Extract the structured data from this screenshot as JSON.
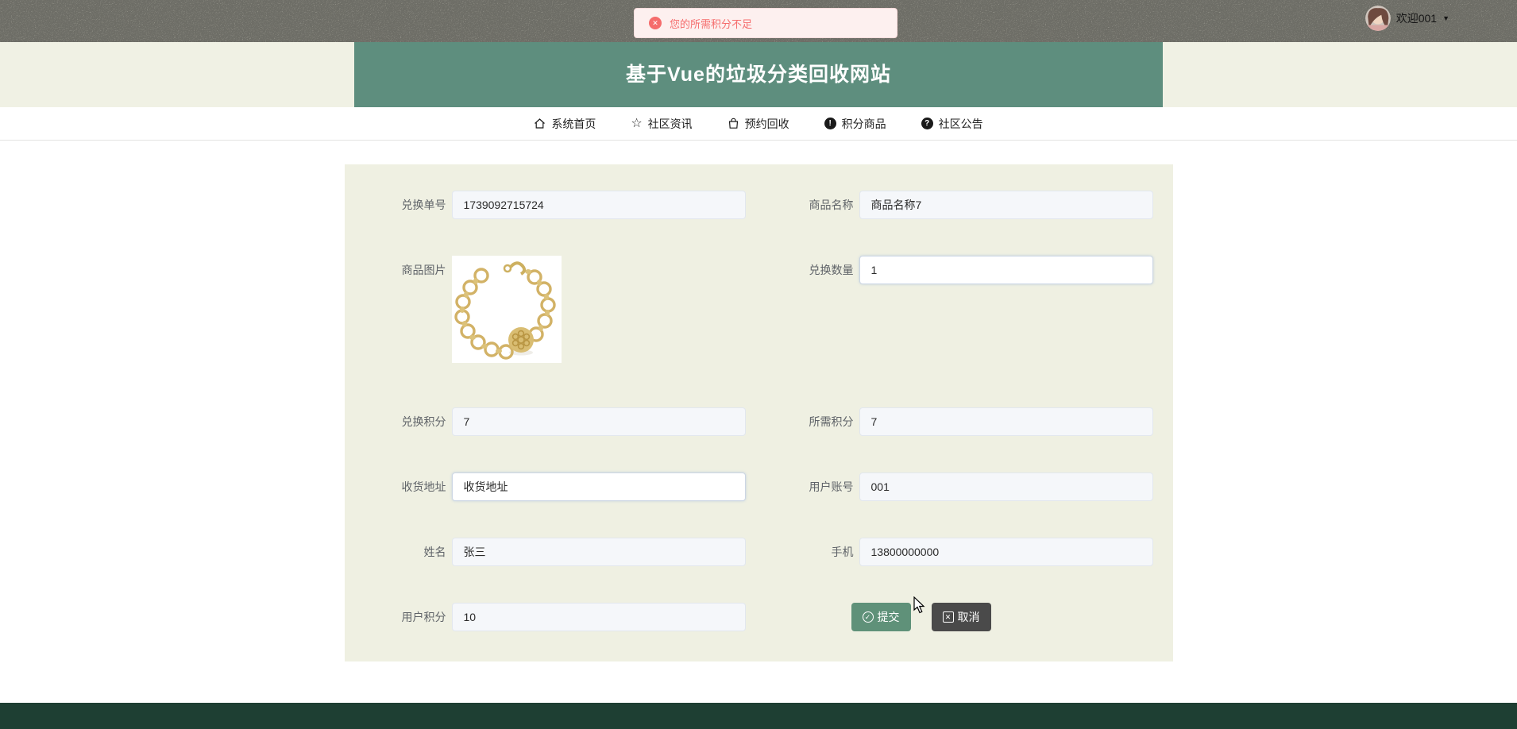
{
  "toast": {
    "message": "您的所需积分不足"
  },
  "user": {
    "welcome": "欢迎001"
  },
  "header": {
    "title": "基于Vue的垃圾分类回收网站"
  },
  "nav": {
    "items": [
      {
        "label": "系统首页",
        "icon": "home-icon"
      },
      {
        "label": "社区资讯",
        "icon": "star-icon"
      },
      {
        "label": "预约回收",
        "icon": "bag-icon"
      },
      {
        "label": "积分商品",
        "icon": "info-circle-icon"
      },
      {
        "label": "社区公告",
        "icon": "question-circle-icon"
      }
    ]
  },
  "form": {
    "fields": {
      "order_no": {
        "label": "兑换单号",
        "value": "1739092715724",
        "readonly": true
      },
      "product_name": {
        "label": "商品名称",
        "value": "商品名称7",
        "readonly": true
      },
      "product_image": {
        "label": "商品图片"
      },
      "quantity": {
        "label": "兑换数量",
        "value": "1",
        "readonly": false
      },
      "exchange_points": {
        "label": "兑换积分",
        "value": "7",
        "readonly": true
      },
      "required_points": {
        "label": "所需积分",
        "value": "7",
        "readonly": true
      },
      "address": {
        "label": "收货地址",
        "value": "收货地址",
        "readonly": false
      },
      "account": {
        "label": "用户账号",
        "value": "001",
        "readonly": true
      },
      "name": {
        "label": "姓名",
        "value": "张三",
        "readonly": true
      },
      "phone": {
        "label": "手机",
        "value": "13800000000",
        "readonly": true
      },
      "user_points": {
        "label": "用户积分",
        "value": "10",
        "readonly": true
      }
    },
    "buttons": {
      "submit": "提交",
      "cancel": "取消"
    }
  },
  "icons": {
    "error": "✕",
    "caret": "▼",
    "info": "!",
    "question": "?",
    "check": "✓",
    "close": "✕",
    "star": "☆"
  },
  "colors": {
    "accent_green": "#5e8e7e",
    "button_green": "#5f9179",
    "footer_green": "#1e3f33",
    "error": "#f56c6c",
    "panel_bg": "#eff0e2",
    "readonly_bg": "#f5f7fa"
  }
}
